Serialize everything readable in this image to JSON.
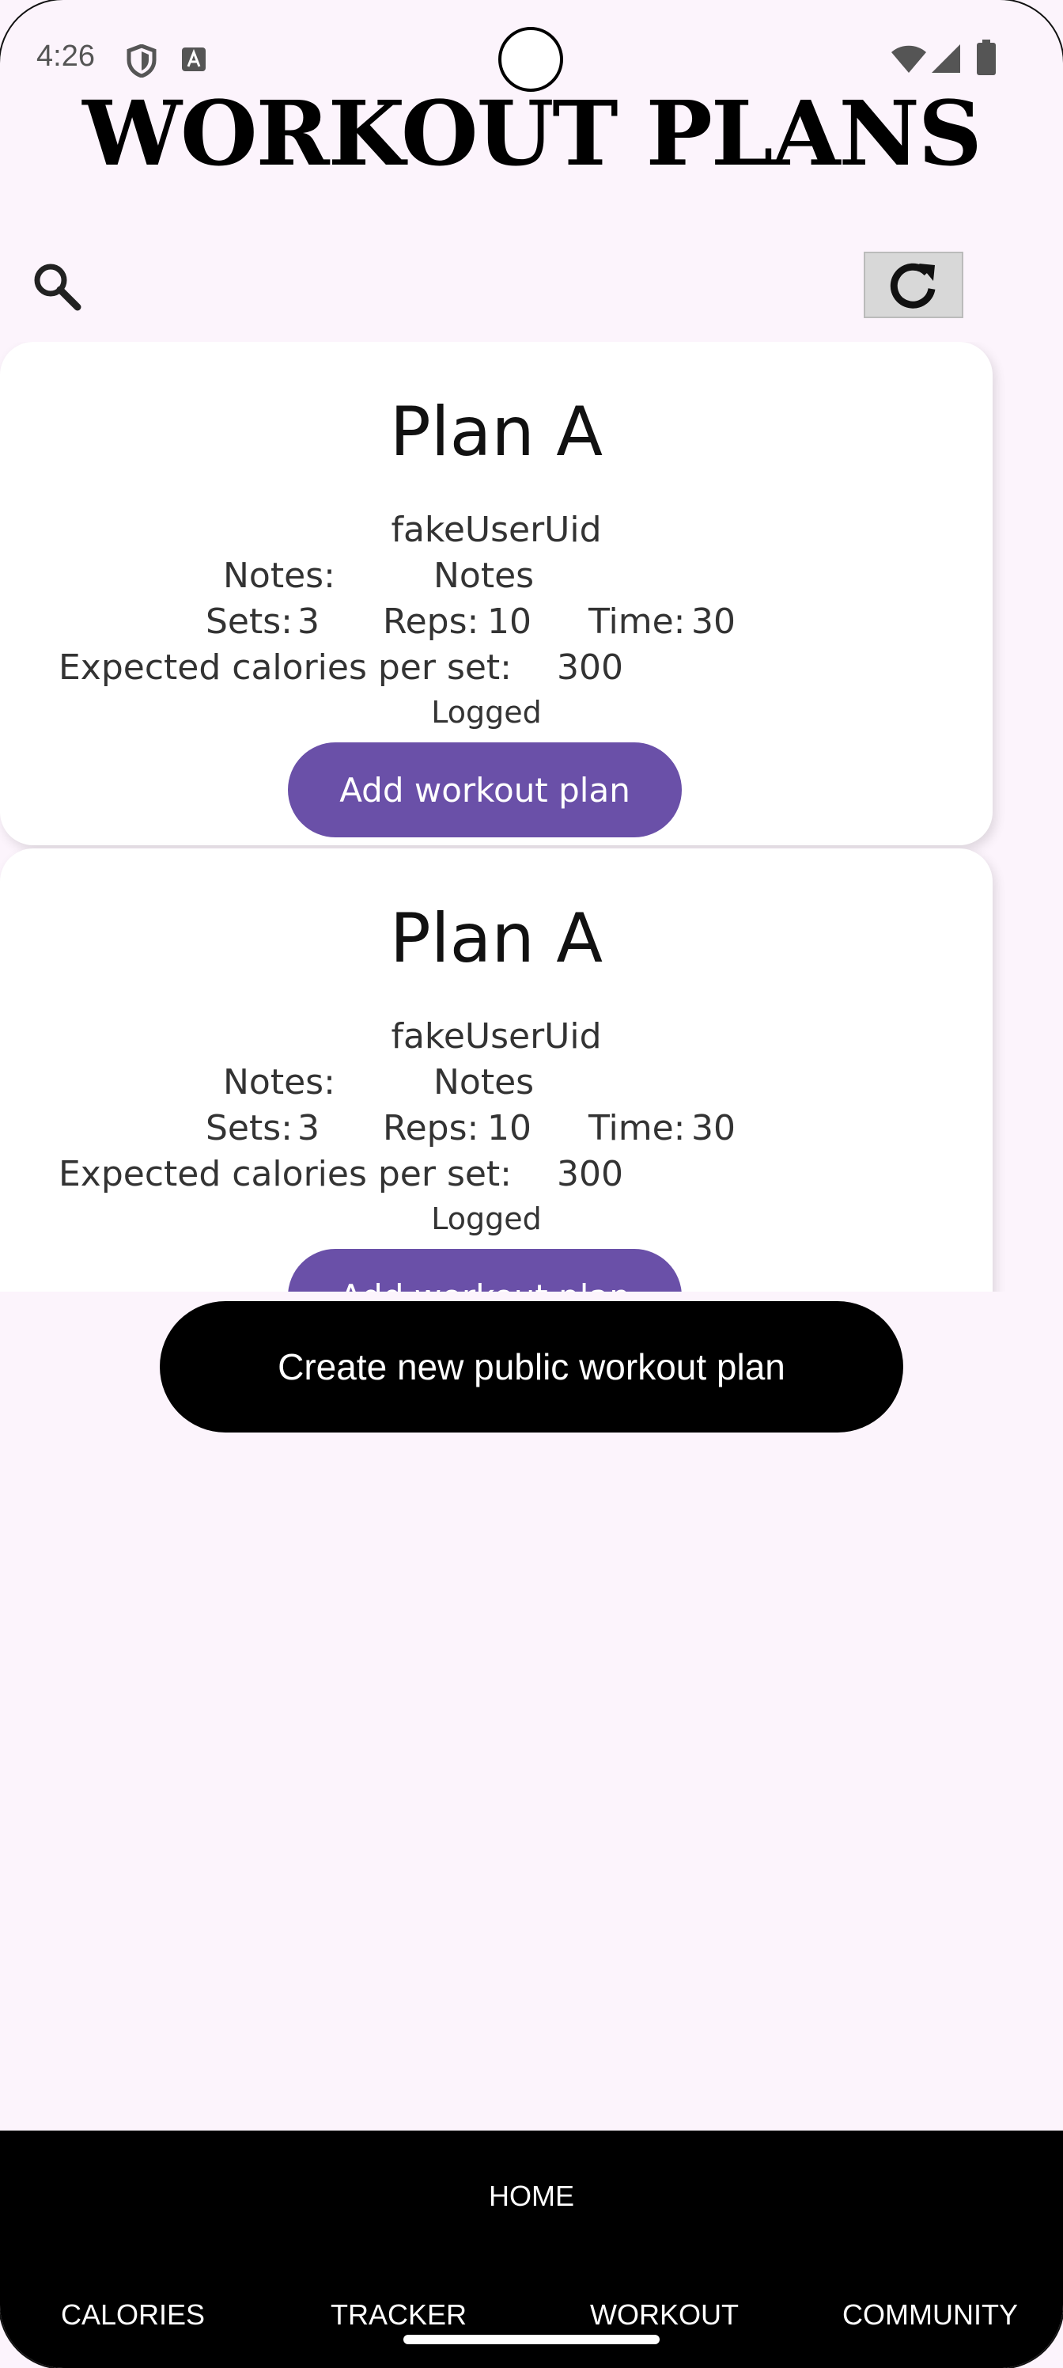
{
  "status_bar": {
    "time": "4:26",
    "icons": [
      "shield-icon",
      "font-a-icon",
      "wifi-icon",
      "signal-icon",
      "battery-icon"
    ]
  },
  "page": {
    "title": "WORKOUT PLANS"
  },
  "toolbar": {
    "search_icon": "search-icon",
    "refresh_icon": "refresh-icon"
  },
  "plans": [
    {
      "name": "Plan A",
      "owner": "fakeUserUid",
      "notes_label": "Notes:",
      "notes_value": "Notes",
      "sets_label": "Sets:",
      "sets_value": "3",
      "reps_label": "Reps:",
      "reps_value": "10",
      "time_label": "Time:",
      "time_value": "30",
      "calories_label": "Expected calories per set:",
      "calories_value": "300",
      "status": "Logged",
      "button_label": "Add workout plan"
    },
    {
      "name": "Plan A",
      "owner": "fakeUserUid",
      "notes_label": "Notes:",
      "notes_value": "Notes",
      "sets_label": "Sets:",
      "sets_value": "3",
      "reps_label": "Reps:",
      "reps_value": "10",
      "time_label": "Time:",
      "time_value": "30",
      "calories_label": "Expected calories per set:",
      "calories_value": "300",
      "status": "Logged",
      "button_label": "Add workout plan"
    }
  ],
  "create_button_label": "Create new public workout plan",
  "bottom_nav": {
    "home": "HOME",
    "items": [
      "CALORIES",
      "TRACKER",
      "WORKOUT",
      "COMMUNITY"
    ]
  },
  "colors": {
    "background": "#fcf4fc",
    "accent": "#6a50a8",
    "nav_background": "#000000"
  }
}
